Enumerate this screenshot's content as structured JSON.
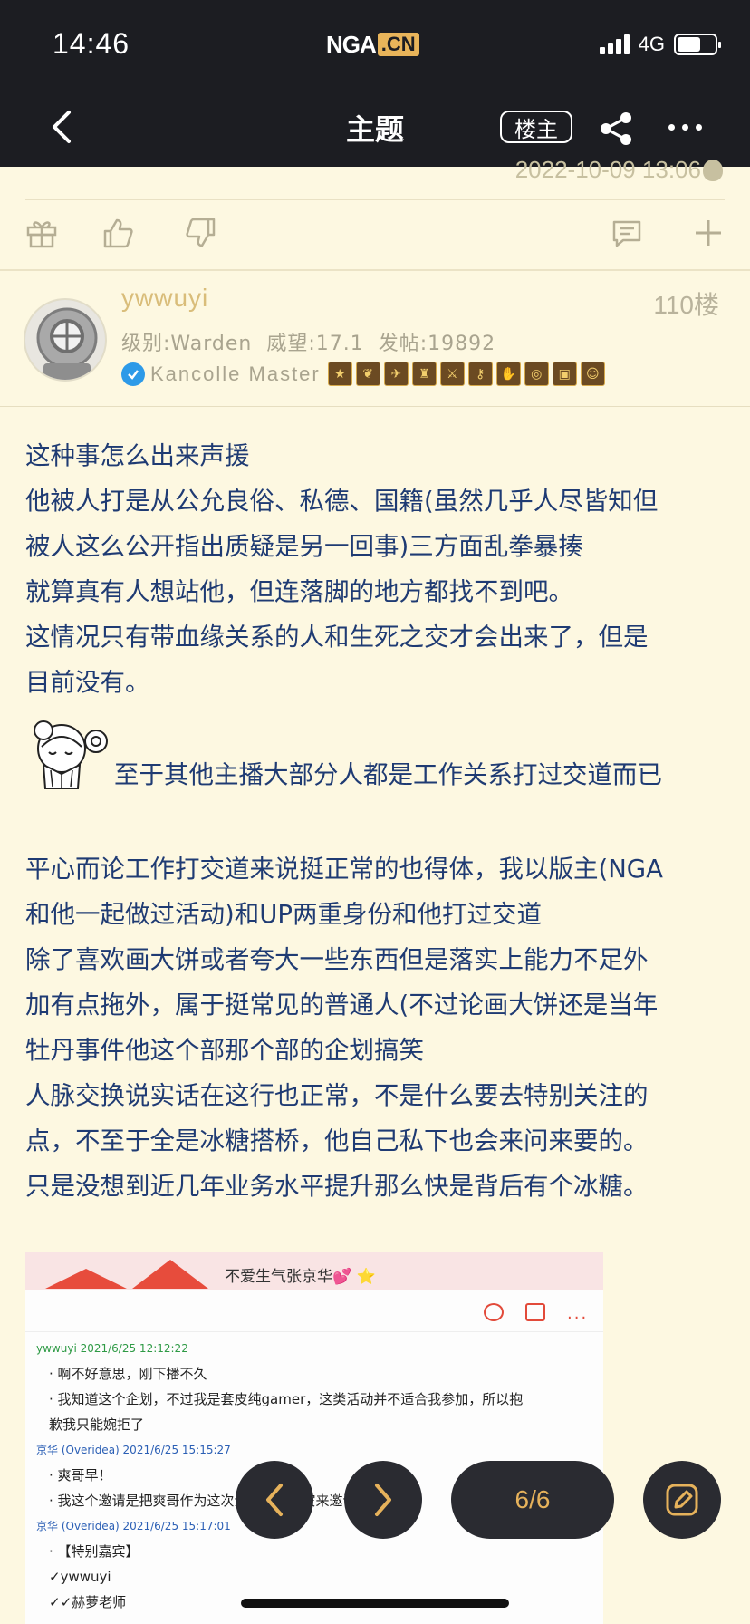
{
  "status_bar": {
    "time": "14:46",
    "logo_main": "NGA",
    "logo_suffix": ".CN",
    "network": "4G",
    "battery_level": 0.62
  },
  "nav": {
    "title": "主题",
    "louzhu_label": "楼主",
    "icons": [
      "back-icon",
      "share-icon",
      "more-icon"
    ]
  },
  "previous_post": {
    "date": "2022-10-09 13:06",
    "actions": [
      "gift-icon",
      "like-icon",
      "dislike-icon",
      "comment-icon",
      "plus-icon"
    ]
  },
  "post": {
    "username": "ywwuyi",
    "floor": "110楼",
    "level": "级别:Warden",
    "reputation": "威望:17.1",
    "posts": "发帖:19892",
    "user_title": "Kancolle Master",
    "lines": [
      "这种事怎么出来声援",
      "他被人打是从公允良俗、私德、国籍(虽然几乎人尽皆知但",
      "被人这么公开指出质疑是另一回事)三方面乱拳暴揍",
      "就算真有人想站他，但连落脚的地方都找不到吧。",
      "这情况只有带血缘关系的人和生死之交才会出来了，但是",
      "目前没有。"
    ],
    "sticker_line": "至于其他主播大部分人都是工作关系打过交道而已",
    "lines2": [
      "平心而论工作打交道来说挺正常的也得体，我以版主(NGA",
      "和他一起做过活动)和UP两重身份和他打过交道",
      "除了喜欢画大饼或者夸大一些东西但是落实上能力不足外",
      "加有点拖外，属于挺常见的普通人(不过论画大饼还是当年",
      "牡丹事件他这个部那个部的企划搞笑",
      "人脉交换说实话在这行也正常，不是什么要去特别关注的",
      "点，不至于全是冰糖搭桥，他自己私下也会来问来要的。",
      "只是没想到近几年业务水平提升那么快是背后有个冰糖。"
    ]
  },
  "image": {
    "title": "不爱生气张京华💕 ⭐",
    "chat": [
      {
        "type": "meta-g",
        "text": "ywwuyi 2021/6/25 12:12:22"
      },
      {
        "type": "msg",
        "text": "· 啊不好意思，刚下播不久"
      },
      {
        "type": "msg",
        "text": "· 我知道这个企划，不过我是套皮纯gamer，这类活动并不适合我参加，所以抱"
      },
      {
        "type": "msg",
        "text": "歉我只能婉拒了"
      },
      {
        "type": "meta-b",
        "text": "京华 (Overidea) 2021/6/25 15:15:27"
      },
      {
        "type": "msg",
        "text": "· 爽哥早！"
      },
      {
        "type": "msg",
        "text": "· 我这个邀请是把爽哥作为这次企划特别嘉宾来邀请的"
      },
      {
        "type": "meta-b",
        "text": "京华 (Overidea) 2021/6/25 15:17:01"
      },
      {
        "type": "msg",
        "text": "· 【特别嘉宾】"
      },
      {
        "type": "msg",
        "text": "✓ywwuyi"
      },
      {
        "type": "msg",
        "text": "✓✓赫萝老师"
      }
    ]
  },
  "pager": {
    "page": "6/6"
  },
  "colors": {
    "accent": "#e6b25b",
    "background": "#fdf8e1",
    "text": "#1f3b73",
    "username": "#d9bd7a"
  }
}
